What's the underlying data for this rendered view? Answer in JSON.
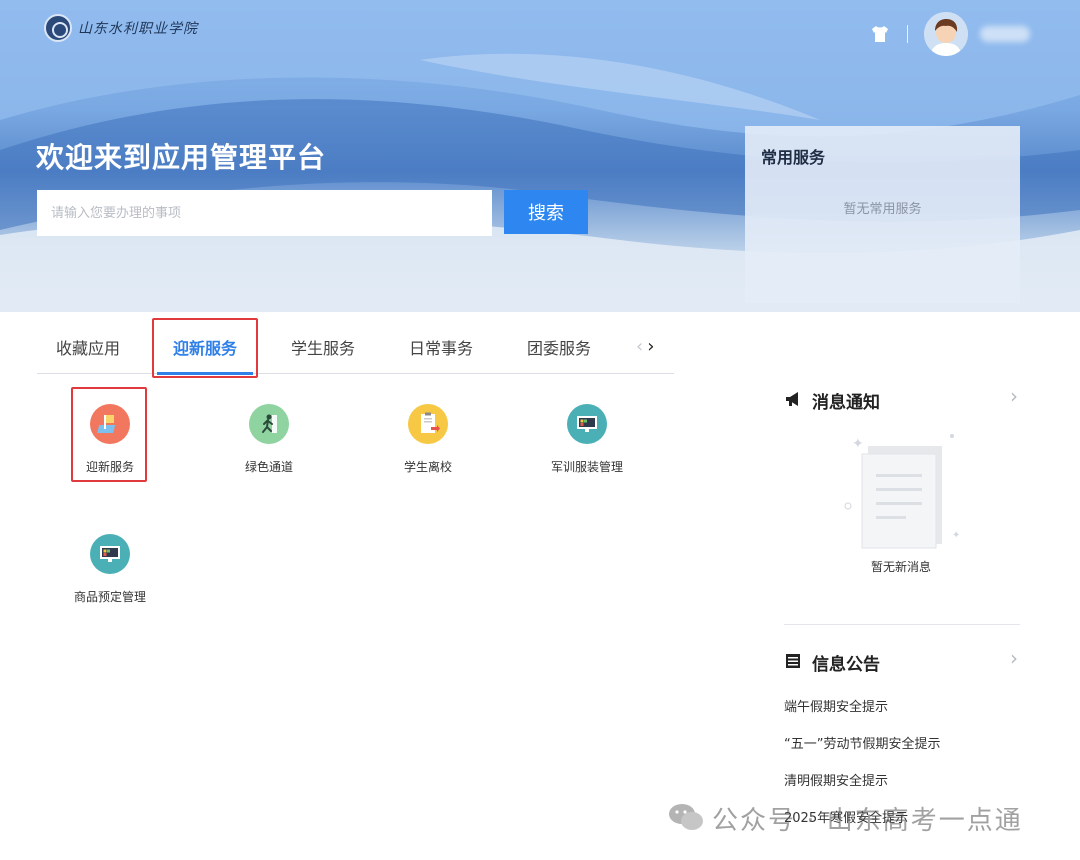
{
  "header": {
    "logo_text": "山东水利职业学院",
    "welcome_title": "欢迎来到应用管理平台",
    "search_placeholder": "请输入您要办理的事项",
    "search_button": "搜索"
  },
  "favorites_panel": {
    "title": "常用服务",
    "empty_text": "暂无常用服务"
  },
  "tabs": {
    "items": [
      {
        "label": "收藏应用",
        "active": false
      },
      {
        "label": "迎新服务",
        "active": true
      },
      {
        "label": "学生服务",
        "active": false
      },
      {
        "label": "日常事务",
        "active": false
      },
      {
        "label": "团委服务",
        "active": false
      }
    ]
  },
  "apps": [
    {
      "label": "迎新服务",
      "icon": "welcome-flag-icon",
      "color": "#f2775f"
    },
    {
      "label": "绿色通道",
      "icon": "running-man-icon",
      "color": "#8fd3a0"
    },
    {
      "label": "学生离校",
      "icon": "document-exit-icon",
      "color": "#f6c843"
    },
    {
      "label": "军训服装管理",
      "icon": "monitor-icon",
      "color": "#4ab0b6"
    },
    {
      "label": "商品预定管理",
      "icon": "monitor-icon",
      "color": "#4ab0b6"
    }
  ],
  "messages_panel": {
    "title": "消息通知",
    "empty_text": "暂无新消息"
  },
  "announcements_panel": {
    "title": "信息公告",
    "items": [
      "端午假期安全提示",
      "“五一”劳动节假期安全提示",
      "清明假期安全提示",
      "2025年寒假安全提示"
    ]
  },
  "watermark": {
    "text": "公众号 · 山东高考一点通"
  },
  "colors": {
    "accent": "#2e7fe8",
    "highlight_border": "#e0393e",
    "search_button": "#2e86f0"
  }
}
